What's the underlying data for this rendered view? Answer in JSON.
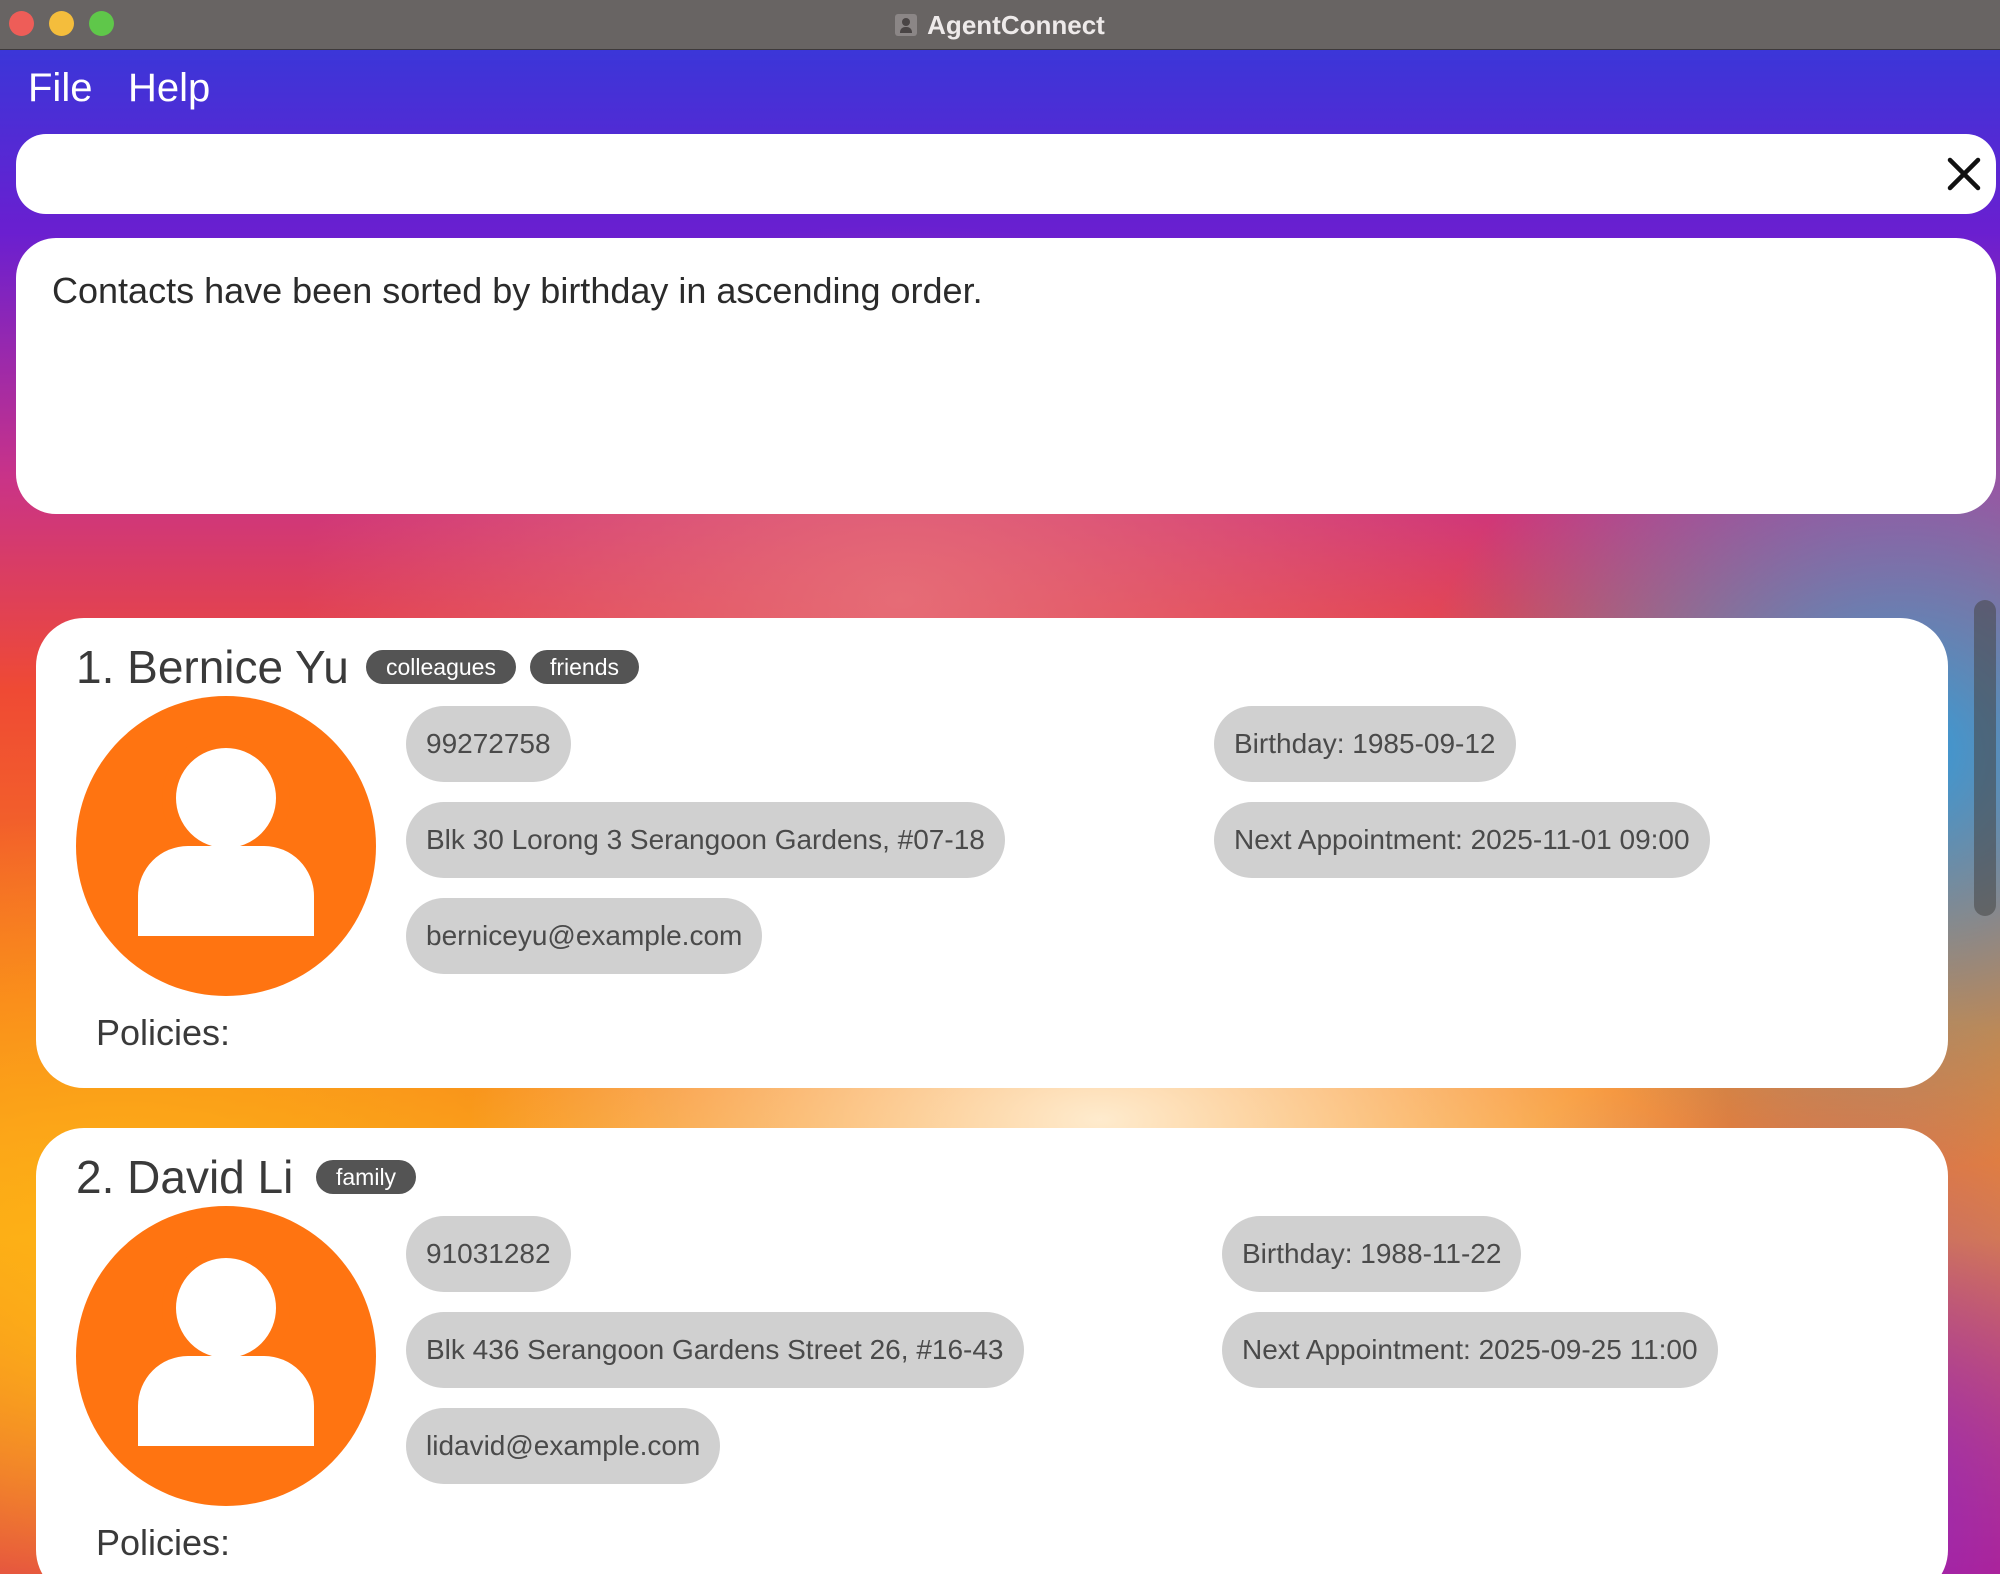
{
  "window": {
    "title": "AgentConnect"
  },
  "menu": {
    "file": "File",
    "help": "Help"
  },
  "command": {
    "value": "",
    "placeholder": ""
  },
  "result": {
    "message": "Contacts have been sorted by birthday in ascending order."
  },
  "contacts": [
    {
      "index_name": "1. Bernice Yu",
      "tags": [
        "colleagues",
        "friends"
      ],
      "phone": "99272758",
      "address": "Blk 30 Lorong 3 Serangoon Gardens, #07-18",
      "email": "berniceyu@example.com",
      "birthday": "Birthday: 1985-09-12",
      "appointment": "Next Appointment: 2025-11-01 09:00",
      "policies_label": "Policies:"
    },
    {
      "index_name": "2. David Li",
      "tags": [
        "family"
      ],
      "phone": "91031282",
      "address": "Blk 436 Serangoon Gardens Street 26, #16-43",
      "email": "lidavid@example.com",
      "birthday": "Birthday: 1988-11-22",
      "appointment": "Next Appointment: 2025-09-25 11:00",
      "policies_label": "Policies:"
    }
  ],
  "colors": {
    "avatar": "#ff7411",
    "tag_bg": "#545454",
    "pill_bg": "#d0d0d0"
  },
  "icons": [
    "close-icon",
    "person-icon",
    "app-icon"
  ]
}
